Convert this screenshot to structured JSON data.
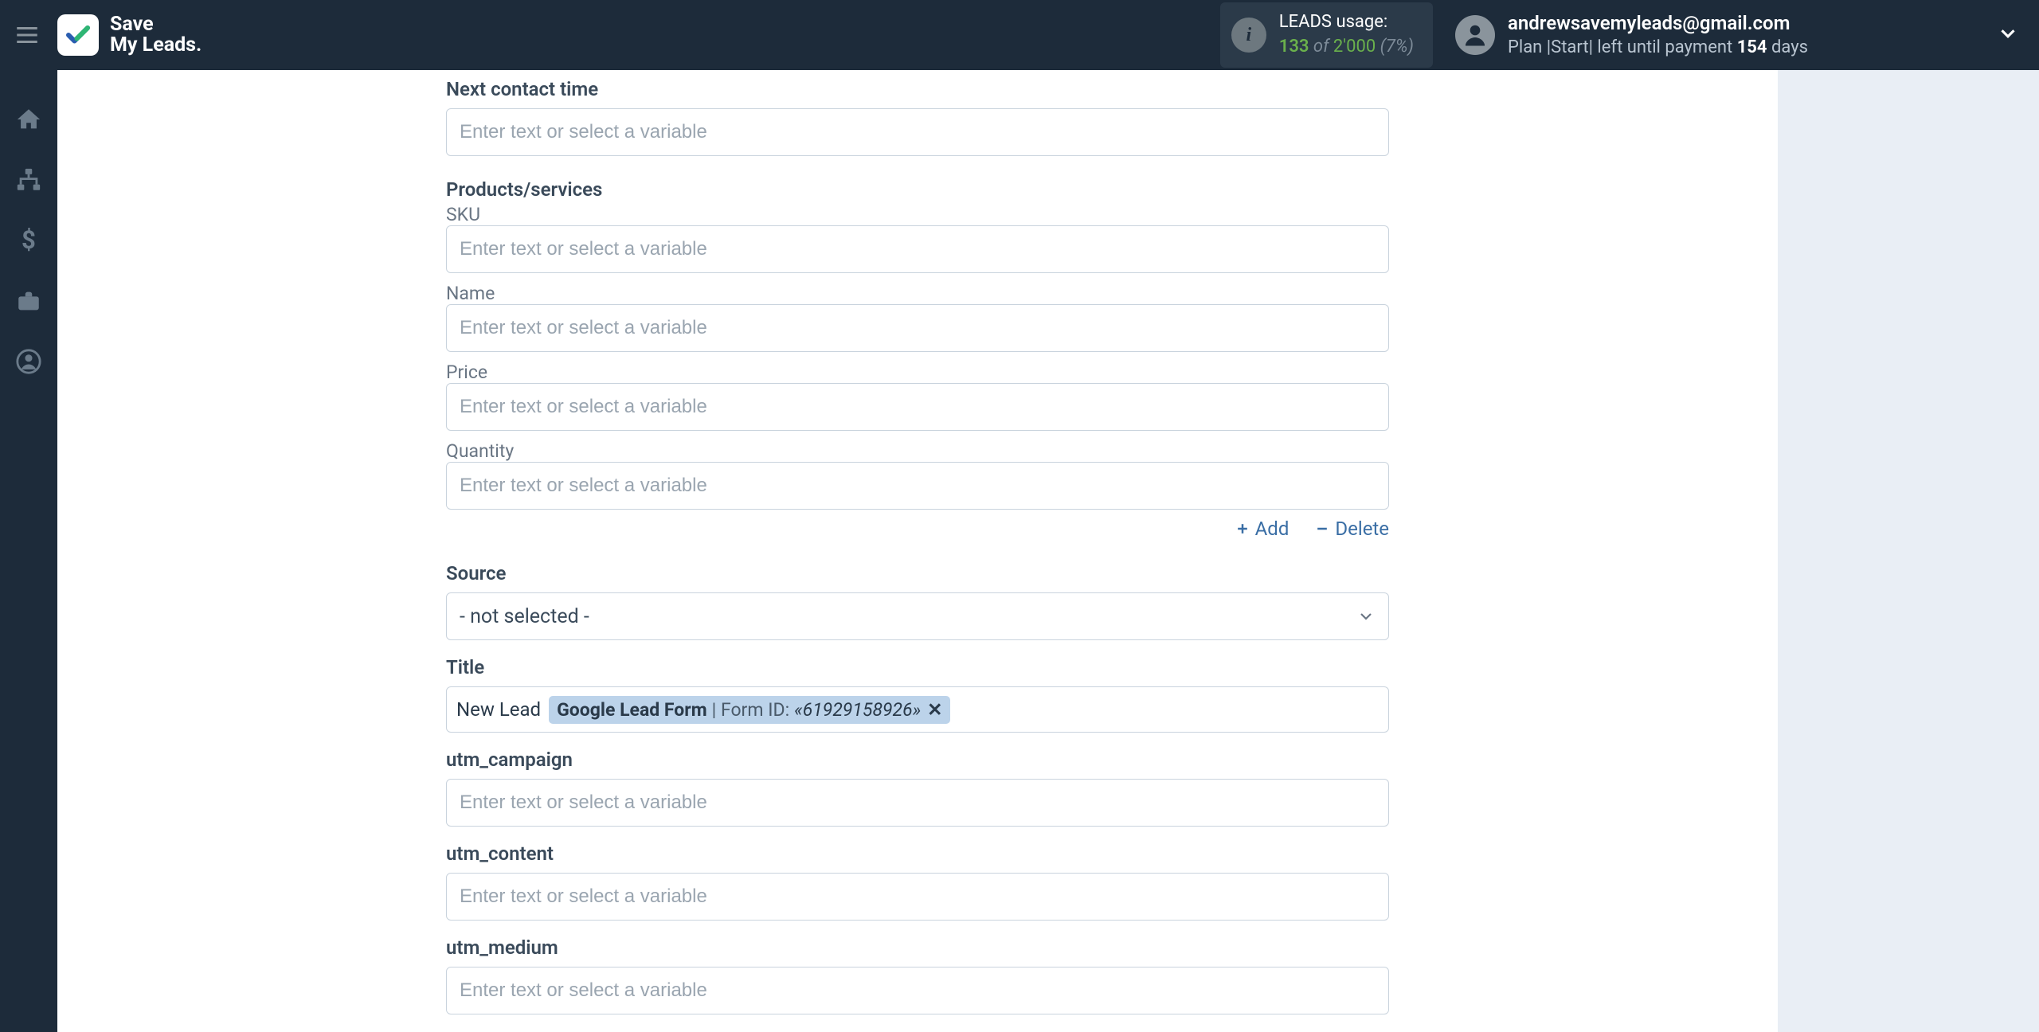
{
  "header": {
    "logo_line1": "Save",
    "logo_line2": "My Leads.",
    "usage_label": "LEADS usage:",
    "usage_used": "133",
    "usage_of": " of ",
    "usage_total": "2'000",
    "usage_pct": " (7%)",
    "account_email": "andrewsavemyleads@gmail.com",
    "account_plan_prefix": "Plan |Start| left until payment ",
    "account_days_num": "154",
    "account_days_suffix": " days"
  },
  "form": {
    "next_contact_time": {
      "label": "Next contact time",
      "placeholder": "Enter text or select a variable",
      "value": ""
    },
    "products_section": "Products/services",
    "sku": {
      "label": "SKU",
      "placeholder": "Enter text or select a variable",
      "value": ""
    },
    "name": {
      "label": "Name",
      "placeholder": "Enter text or select a variable",
      "value": ""
    },
    "price": {
      "label": "Price",
      "placeholder": "Enter text or select a variable",
      "value": ""
    },
    "quantity": {
      "label": "Quantity",
      "placeholder": "Enter text or select a variable",
      "value": ""
    },
    "actions": {
      "add": "Add",
      "delete": "Delete"
    },
    "source": {
      "label": "Source",
      "selected": "- not selected -"
    },
    "title": {
      "label": "Title",
      "leading": "New Lead",
      "chip_bold": "Google Lead Form",
      "chip_sep": " | Form ID: ",
      "chip_italic": "«61929158926»"
    },
    "utm_campaign": {
      "label": "utm_campaign",
      "placeholder": "Enter text or select a variable",
      "value": ""
    },
    "utm_content": {
      "label": "utm_content",
      "placeholder": "Enter text or select a variable",
      "value": ""
    },
    "utm_medium": {
      "label": "utm_medium",
      "placeholder": "Enter text or select a variable",
      "value": ""
    }
  }
}
